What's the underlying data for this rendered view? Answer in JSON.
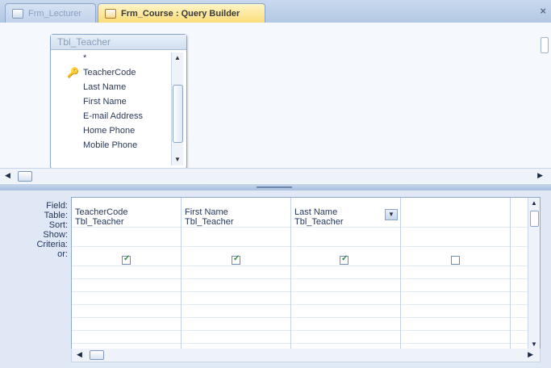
{
  "tabs": [
    {
      "label": "Frm_Lecturer",
      "active": false
    },
    {
      "label": "Frm_Course : Query Builder",
      "active": true
    }
  ],
  "table_box": {
    "title": "Tbl_Teacher",
    "fields": [
      "*",
      "TeacherCode",
      "Last Name",
      "First Name",
      "E-mail Address",
      "Home Phone",
      "Mobile Phone"
    ]
  },
  "grid": {
    "row_labels": [
      "Field:",
      "Table:",
      "Sort:",
      "Show:",
      "Criteria:",
      "or:"
    ],
    "columns": [
      {
        "field": "TeacherCode",
        "table": "Tbl_Teacher",
        "show": true
      },
      {
        "field": "First Name",
        "table": "Tbl_Teacher",
        "show": true
      },
      {
        "field": "Last Name",
        "table": "Tbl_Teacher",
        "show": true
      },
      {
        "field": "",
        "table": "",
        "show": false
      }
    ]
  },
  "colors": {
    "accent_tab": "#fbdc7a",
    "grid_border": "#8fa9cc"
  }
}
